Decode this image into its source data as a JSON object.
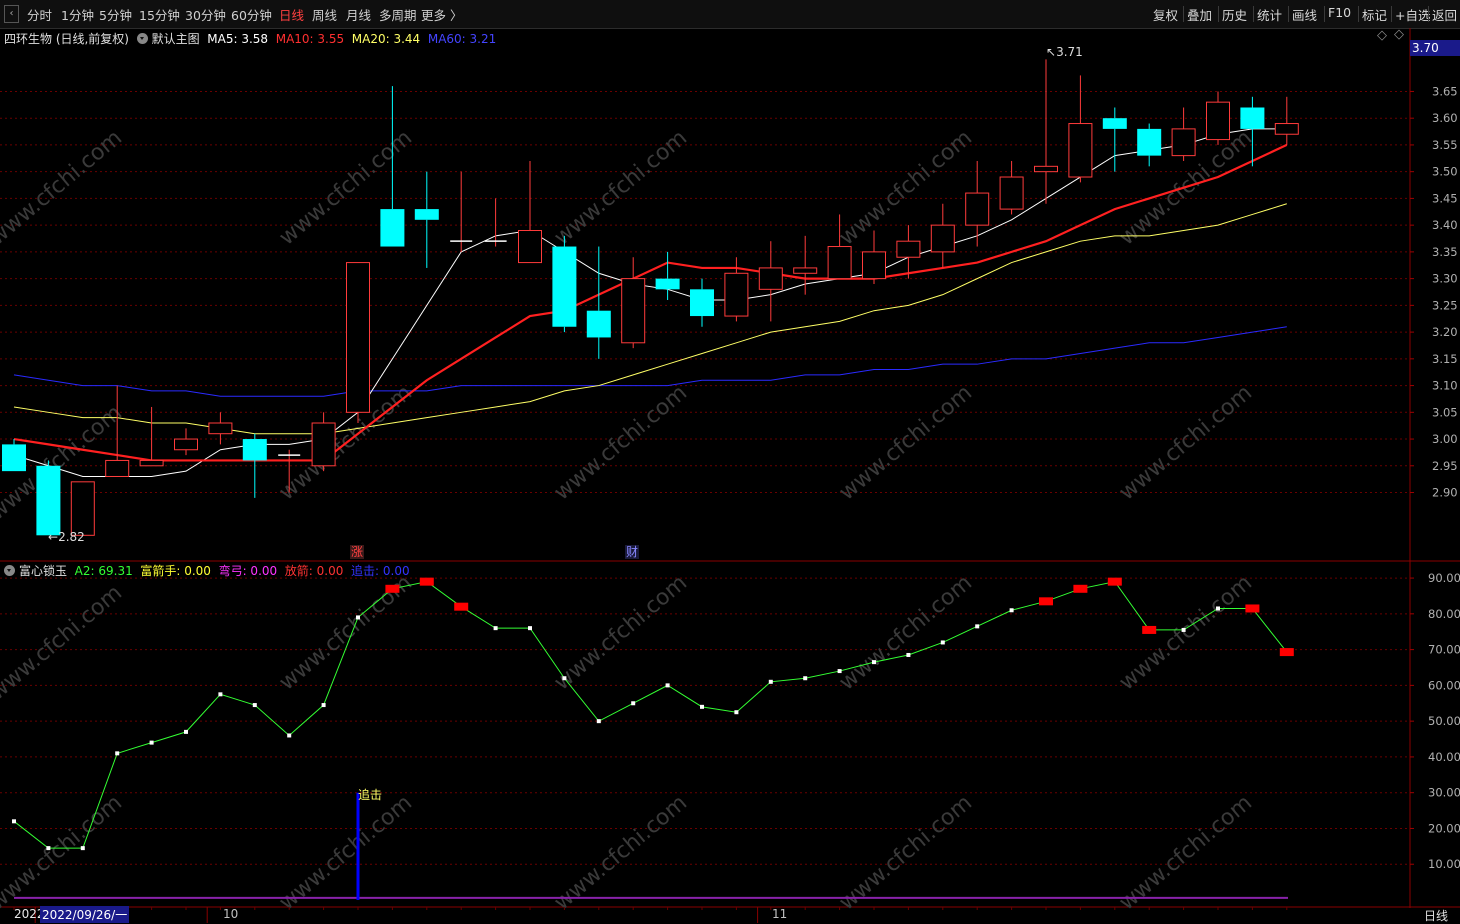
{
  "toolbar": {
    "period_tabs": [
      "分时",
      "1分钟",
      "5分钟",
      "15分钟",
      "30分钟",
      "60分钟",
      "日线",
      "周线",
      "月线",
      "多周期",
      "更多 〉"
    ],
    "active_tab": "日线",
    "right_buttons": [
      "复权",
      "叠加",
      "历史",
      "统计",
      "画线",
      "F10",
      "标记",
      "+自选",
      "返回"
    ]
  },
  "main_panel": {
    "stock_label": "四环生物 (日线,前复权)",
    "template_label": "默认主图",
    "ma_items": [
      {
        "label": "MA5: 3.58",
        "color": "#ffffff"
      },
      {
        "label": "MA10: 3.55",
        "color": "#ff3030"
      },
      {
        "label": "MA20: 3.44",
        "color": "#ffff66"
      },
      {
        "label": "MA60: 3.21",
        "color": "#3333ff"
      }
    ],
    "current_price": "3.70",
    "high_marker": "3.71",
    "low_marker": "2.82",
    "event_marks": [
      "涨",
      "财"
    ],
    "price_ticks": [
      "3.65",
      "3.60",
      "3.55",
      "3.50",
      "3.45",
      "3.40",
      "3.35",
      "3.30",
      "3.25",
      "3.20",
      "3.15",
      "3.10",
      "3.05",
      "3.00",
      "2.95",
      "2.90"
    ]
  },
  "indicator_panel": {
    "name": "富心锁玉",
    "items": [
      {
        "label": "A2: 69.31",
        "color": "#33ff33"
      },
      {
        "label": "富箭手: 0.00",
        "color": "#ffff33"
      },
      {
        "label": "弯弓: 0.00",
        "color": "#ff33ff"
      },
      {
        "label": "放箭: 0.00",
        "color": "#ff3333"
      },
      {
        "label": "追击: 0.00",
        "color": "#3333ff"
      }
    ],
    "chase_label": "追击",
    "ticks": [
      "90.00",
      "80.00",
      "70.00",
      "60.00",
      "50.00",
      "40.00",
      "30.00",
      "20.00",
      "10.00"
    ]
  },
  "time_axis": {
    "labels": [
      "2022",
      "2022/09/26/一",
      "10",
      "11"
    ],
    "period_label": "日线"
  },
  "watermark": "www.cfchi.com",
  "colors": {
    "up": "#ff3b3b",
    "down": "#00ffff",
    "ma5": "#ffffff",
    "ma10": "#ff2020",
    "ma20": "#ffff66",
    "ma60": "#2a2aff",
    "a2_line": "#33ff33",
    "signal": "#ff0000",
    "axis_red": "#a00000",
    "chase": "#0000ff"
  },
  "chart_data": {
    "type": "candlestick",
    "candles": [
      [
        2.99,
        2.94,
        3.0,
        2.94
      ],
      [
        2.95,
        2.82,
        2.96,
        2.82
      ],
      [
        2.82,
        2.92,
        2.92,
        2.82
      ],
      [
        2.93,
        2.96,
        3.1,
        2.93
      ],
      [
        2.95,
        2.96,
        3.06,
        2.95
      ],
      [
        2.98,
        3.0,
        3.02,
        2.97
      ],
      [
        3.01,
        3.03,
        3.05,
        2.99
      ],
      [
        3.0,
        2.96,
        3.01,
        2.89
      ],
      [
        2.97,
        2.97,
        2.98,
        2.9
      ],
      [
        2.95,
        3.03,
        3.05,
        2.94
      ],
      [
        3.05,
        3.33,
        3.33,
        3.03
      ],
      [
        3.43,
        3.36,
        3.66,
        3.36
      ],
      [
        3.43,
        3.41,
        3.5,
        3.32
      ],
      [
        3.37,
        3.37,
        3.5,
        3.35
      ],
      [
        3.37,
        3.37,
        3.45,
        3.36
      ],
      [
        3.33,
        3.39,
        3.52,
        3.33
      ],
      [
        3.36,
        3.21,
        3.38,
        3.2
      ],
      [
        3.24,
        3.19,
        3.36,
        3.15
      ],
      [
        3.18,
        3.3,
        3.34,
        3.17
      ],
      [
        3.3,
        3.28,
        3.35,
        3.26
      ],
      [
        3.28,
        3.23,
        3.3,
        3.21
      ],
      [
        3.23,
        3.31,
        3.34,
        3.22
      ],
      [
        3.28,
        3.32,
        3.37,
        3.22
      ],
      [
        3.31,
        3.32,
        3.38,
        3.27
      ],
      [
        3.3,
        3.36,
        3.42,
        3.3
      ],
      [
        3.3,
        3.35,
        3.39,
        3.29
      ],
      [
        3.34,
        3.37,
        3.4,
        3.3
      ],
      [
        3.35,
        3.4,
        3.44,
        3.32
      ],
      [
        3.4,
        3.46,
        3.52,
        3.36
      ],
      [
        3.43,
        3.49,
        3.52,
        3.42
      ],
      [
        3.5,
        3.51,
        3.71,
        3.44
      ],
      [
        3.49,
        3.59,
        3.68,
        3.48
      ],
      [
        3.6,
        3.58,
        3.62,
        3.5
      ],
      [
        3.58,
        3.53,
        3.59,
        3.51
      ],
      [
        3.53,
        3.58,
        3.62,
        3.52
      ],
      [
        3.56,
        3.63,
        3.65,
        3.55
      ],
      [
        3.62,
        3.58,
        3.64,
        3.51
      ],
      [
        3.57,
        3.59,
        3.64,
        3.55
      ]
    ],
    "ma5": [
      2.97,
      2.95,
      2.93,
      2.93,
      2.93,
      2.94,
      2.98,
      2.99,
      2.99,
      3.0,
      3.05,
      3.15,
      3.25,
      3.35,
      3.38,
      3.39,
      3.35,
      3.31,
      3.29,
      3.28,
      3.26,
      3.26,
      3.27,
      3.29,
      3.3,
      3.31,
      3.34,
      3.36,
      3.38,
      3.41,
      3.45,
      3.49,
      3.53,
      3.54,
      3.55,
      3.57,
      3.58,
      3.58
    ],
    "ma10": [
      3.0,
      2.99,
      2.98,
      2.97,
      2.96,
      2.96,
      2.96,
      2.96,
      2.96,
      2.96,
      3.01,
      3.06,
      3.11,
      3.15,
      3.19,
      3.23,
      3.24,
      3.27,
      3.3,
      3.33,
      3.32,
      3.32,
      3.31,
      3.3,
      3.3,
      3.3,
      3.31,
      3.32,
      3.33,
      3.35,
      3.37,
      3.4,
      3.43,
      3.45,
      3.47,
      3.49,
      3.52,
      3.55
    ],
    "ma20": [
      3.06,
      3.05,
      3.04,
      3.04,
      3.03,
      3.03,
      3.02,
      3.01,
      3.01,
      3.01,
      3.02,
      3.03,
      3.04,
      3.05,
      3.06,
      3.07,
      3.09,
      3.1,
      3.12,
      3.14,
      3.16,
      3.18,
      3.2,
      3.21,
      3.22,
      3.24,
      3.25,
      3.27,
      3.3,
      3.33,
      3.35,
      3.37,
      3.38,
      3.38,
      3.39,
      3.4,
      3.42,
      3.44
    ],
    "ma60": [
      3.12,
      3.11,
      3.1,
      3.1,
      3.09,
      3.09,
      3.08,
      3.08,
      3.08,
      3.08,
      3.09,
      3.09,
      3.09,
      3.1,
      3.1,
      3.1,
      3.1,
      3.1,
      3.1,
      3.1,
      3.11,
      3.11,
      3.11,
      3.12,
      3.12,
      3.13,
      3.13,
      3.14,
      3.14,
      3.15,
      3.15,
      3.16,
      3.17,
      3.18,
      3.18,
      3.19,
      3.2,
      3.21
    ],
    "a2": [
      22,
      14.5,
      14.5,
      41,
      44,
      47,
      57.5,
      54.5,
      46,
      54.5,
      79,
      87,
      89,
      82,
      76,
      76,
      62,
      50,
      55,
      60,
      54,
      52.5,
      61,
      62,
      64,
      66.5,
      68.5,
      72,
      76.5,
      81,
      83.5,
      87,
      89,
      75.5,
      75.5,
      81.5,
      81.5,
      69.31
    ],
    "a2_signals": [
      11,
      12,
      13,
      30,
      31,
      32,
      33,
      36,
      37
    ],
    "chase_bar_index": 10,
    "chase_value": 30,
    "price_range": [
      2.8,
      3.735
    ],
    "indicator_range": [
      0,
      100
    ],
    "date_labels_at": {
      "2022/09/26/一": 1,
      "10": 6,
      "11": 22
    }
  }
}
